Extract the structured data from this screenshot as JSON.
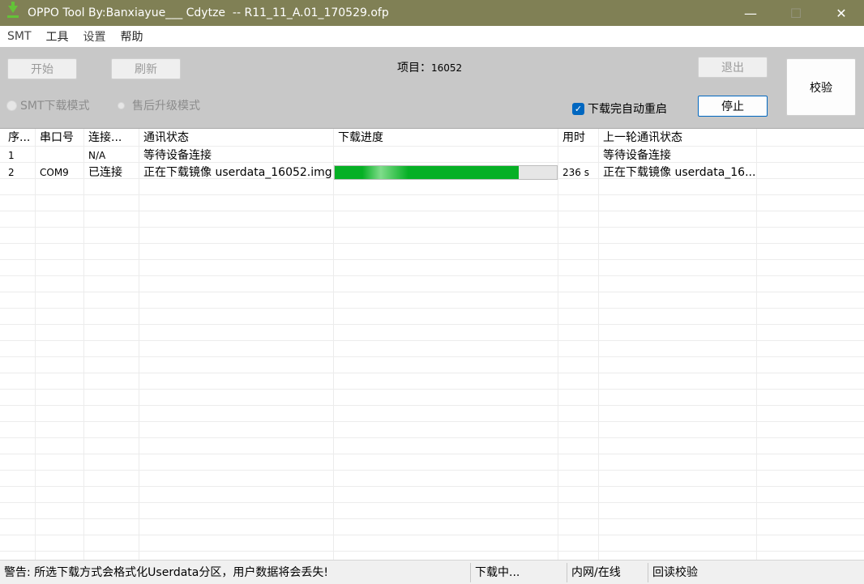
{
  "window": {
    "title": "OPPO Tool By:Banxiayue___ Cdytze  -- R11_11_A.01_170529.ofp",
    "minimize_icon": "—",
    "maximize_icon": "☐",
    "close_icon": "✕"
  },
  "menu": [
    "SMT",
    "工具",
    "设置",
    "帮助"
  ],
  "toolbar": {
    "start_label": "开始",
    "refresh_label": "刷新",
    "project_label": "项目：",
    "project_value": "16052",
    "exit_label": "退出",
    "verify_label": "校验",
    "stop_label": "停止",
    "smt_mode_label": "SMT下载模式",
    "aftersale_mode_label": "售后升级模式",
    "auto_reboot_label": "下载完自动重启",
    "auto_reboot_checked": true
  },
  "table": {
    "columns": [
      "序...",
      "串口号",
      "连接...",
      "通讯状态",
      "下载进度",
      "用时",
      "上一轮通讯状态"
    ],
    "rows": [
      {
        "index": "1",
        "port": "",
        "conn": "N/A",
        "status": "等待设备连接",
        "progress": null,
        "time": "",
        "last_status": "等待设备连接"
      },
      {
        "index": "2",
        "port": "COM9",
        "conn": "已连接",
        "status": "正在下载镜像 userdata_16052.img",
        "progress": 0.83,
        "time": "236 s",
        "last_status": "正在下载镜像 userdata_16..."
      }
    ]
  },
  "statusbar": {
    "warning": "警告: 所选下载方式会格式化Userdata分区，用户数据将会丢失!",
    "state": "下载中...",
    "network": "内网/在线",
    "readback": "回读校验"
  },
  "colors": {
    "titlebar": "#808055",
    "toolbar": "#c8c8c8",
    "progress_fill": "#06b025",
    "accent": "#0067c0"
  }
}
